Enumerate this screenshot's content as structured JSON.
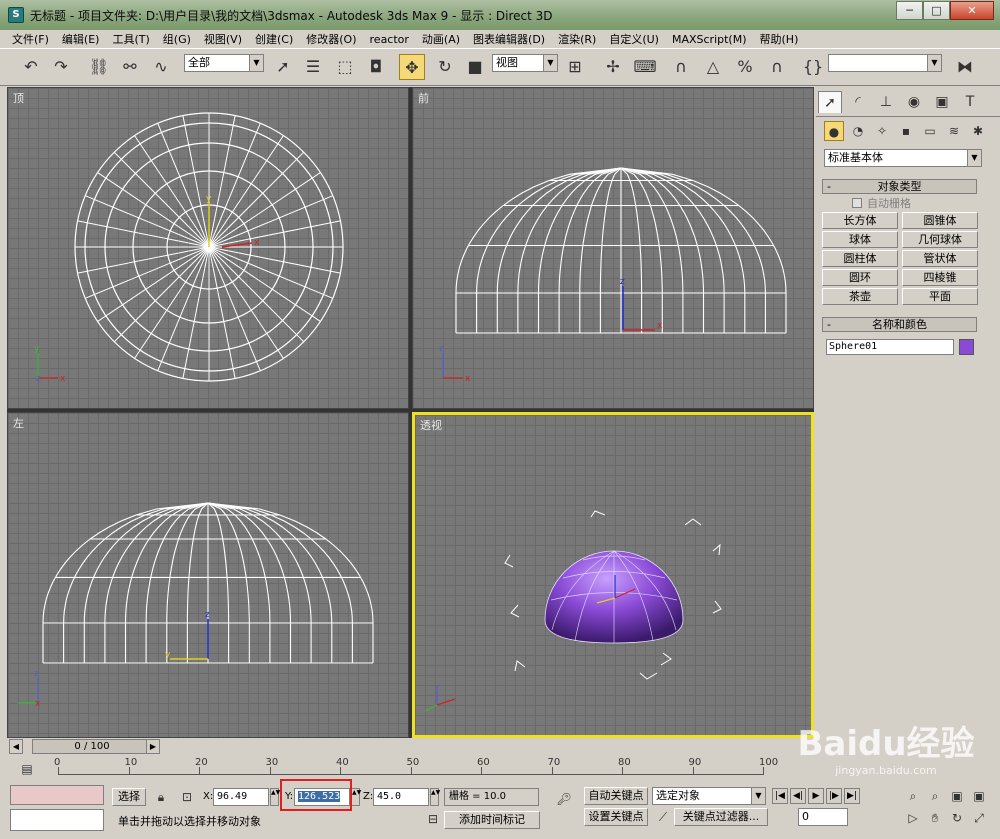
{
  "window": {
    "title": "无标题    - 项目文件夹: D:\\用户目录\\我的文档\\3dsmax    - Autodesk 3ds Max 9    - 显示 : Direct 3D",
    "app_icon": "3ds-max-icon",
    "buttons": {
      "minimize": "─",
      "maximize": "□",
      "close": "✕"
    }
  },
  "menu": [
    "文件(F)",
    "编辑(E)",
    "工具(T)",
    "组(G)",
    "视图(V)",
    "创建(C)",
    "修改器(O)",
    "reactor",
    "动画(A)",
    "图表编辑器(D)",
    "渲染(R)",
    "自定义(U)",
    "MAXScript(M)",
    "帮助(H)"
  ],
  "toolbar": {
    "selection_filter": "全部",
    "ref_coord": "视图",
    "named_selection": "",
    "icons": [
      "undo-icon",
      "redo-icon",
      "link-icon",
      "unlink-icon",
      "bind-space-warp-icon",
      "select-icon",
      "select-by-name-icon",
      "rect-selection-icon",
      "window-crossing-icon",
      "move-icon",
      "rotate-icon",
      "scale-icon",
      "use-pivot-icon",
      "manipulate-icon",
      "keyboard-shortcut-icon",
      "snap-3d-icon",
      "angle-snap-icon",
      "percent-snap-icon",
      "spinner-snap-icon",
      "edit-named-selection-icon",
      "mirror-icon"
    ]
  },
  "viewports": {
    "top": {
      "label": "顶"
    },
    "front": {
      "label": "前"
    },
    "left": {
      "label": "左"
    },
    "perspective": {
      "label": "透视"
    }
  },
  "command_panel": {
    "category": "标准基本体",
    "object_type": {
      "title": "对象类型",
      "autogrid": "自动栅格",
      "buttons": [
        "长方体",
        "圆锥体",
        "球体",
        "几何球体",
        "圆柱体",
        "管状体",
        "圆环",
        "四棱锥",
        "茶壶",
        "平面"
      ]
    },
    "name_color": {
      "title": "名称和颜色",
      "name": "Sphere01",
      "color": "#8a4ad6"
    },
    "rollout_minus": "-"
  },
  "timeline": {
    "frame_display": "0 / 100",
    "ticks": [
      "0",
      "10",
      "20",
      "30",
      "40",
      "50",
      "60",
      "70",
      "80",
      "90",
      "100"
    ]
  },
  "status": {
    "selection_label": "选择",
    "x_label": "X:",
    "x_value": "96.49",
    "y_label": "Y:",
    "y_value": "126.523",
    "z_label": "Z:",
    "z_value": "45.0",
    "grid": "栅格 = 10.0",
    "auto_key": "自动关键点",
    "set_key": "设置关键点",
    "key_mode": "选定对象",
    "key_filters": "关键点过滤器...",
    "prompt": "单击并拖动以选择并移动对象",
    "add_time_tag": "添加时间标记",
    "frame_field": "0"
  },
  "watermark": {
    "brand": "Baidu经验",
    "url": "jingyan.baidu.com"
  }
}
